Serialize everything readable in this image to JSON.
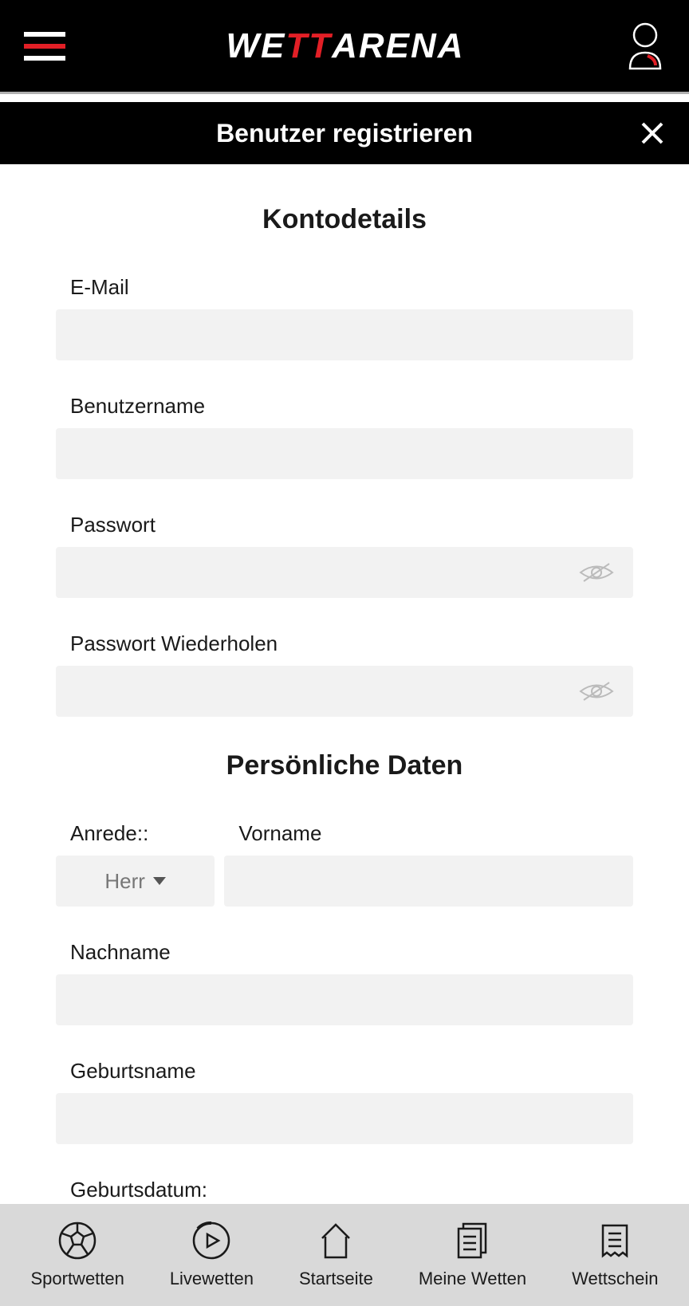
{
  "header": {
    "logo_part1": "WE",
    "logo_part2": "TT",
    "logo_part3": "ARENA"
  },
  "page": {
    "title": "Benutzer registrieren"
  },
  "sections": {
    "account": {
      "title": "Kontodetails",
      "email_label": "E-Mail",
      "username_label": "Benutzername",
      "password_label": "Passwort",
      "password_repeat_label": "Passwort Wiederholen"
    },
    "personal": {
      "title": "Persönliche Daten",
      "salutation_label": "Anrede::",
      "salutation_value": "Herr",
      "firstname_label": "Vorname",
      "lastname_label": "Nachname",
      "birthname_label": "Geburtsname",
      "birthdate_label": "Geburtsdatum:"
    }
  },
  "nav": {
    "items": [
      {
        "label": "Sportwetten"
      },
      {
        "label": "Livewetten"
      },
      {
        "label": "Startseite"
      },
      {
        "label": "Meine Wetten"
      },
      {
        "label": "Wettschein"
      }
    ]
  }
}
